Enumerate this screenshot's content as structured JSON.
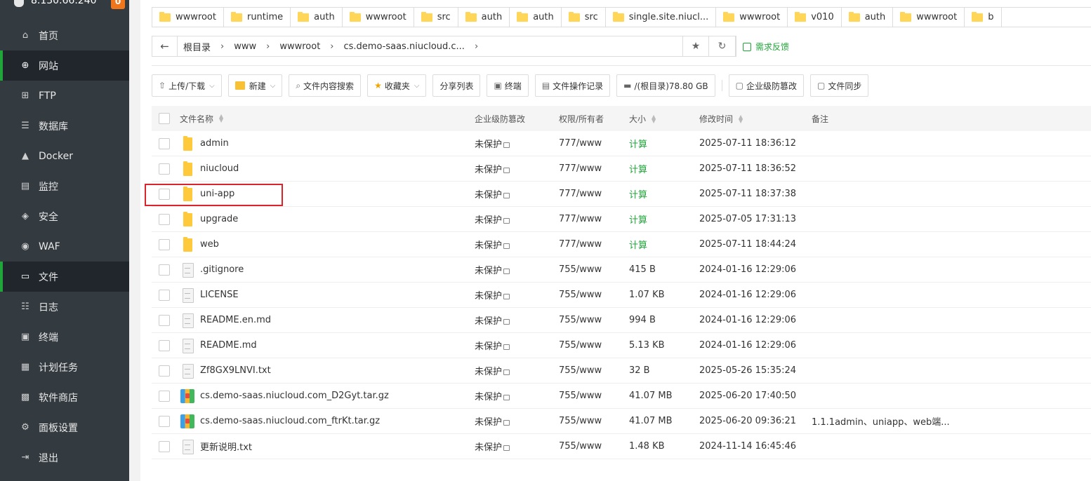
{
  "server": {
    "ip": "8.130.66.240",
    "badge": "0"
  },
  "nav": [
    {
      "label": "首页",
      "icon": "home-icon",
      "glyph": "⌂",
      "active": false
    },
    {
      "label": "网站",
      "icon": "globe-icon",
      "glyph": "⊕",
      "active": true
    },
    {
      "label": "FTP",
      "icon": "ftp-icon",
      "glyph": "⊞",
      "active": false
    },
    {
      "label": "数据库",
      "icon": "database-icon",
      "glyph": "☰",
      "active": false
    },
    {
      "label": "Docker",
      "icon": "docker-icon",
      "glyph": "▲",
      "active": false
    },
    {
      "label": "监控",
      "icon": "monitor-icon",
      "glyph": "▤",
      "active": false
    },
    {
      "label": "安全",
      "icon": "shield-icon",
      "glyph": "◈",
      "active": false
    },
    {
      "label": "WAF",
      "icon": "waf-icon",
      "glyph": "◉",
      "active": false
    },
    {
      "label": "文件",
      "icon": "folder-icon",
      "glyph": "▭",
      "active": true
    },
    {
      "label": "日志",
      "icon": "log-icon",
      "glyph": "☷",
      "active": false
    },
    {
      "label": "终端",
      "icon": "terminal-icon",
      "glyph": "▣",
      "active": false
    },
    {
      "label": "计划任务",
      "icon": "calendar-icon",
      "glyph": "▦",
      "active": false
    },
    {
      "label": "软件商店",
      "icon": "store-icon",
      "glyph": "▩",
      "active": false
    },
    {
      "label": "面板设置",
      "icon": "gear-icon",
      "glyph": "⚙",
      "active": false
    },
    {
      "label": "退出",
      "icon": "logout-icon",
      "glyph": "⇥",
      "active": false
    }
  ],
  "bookmarks": [
    "wwwroot",
    "runtime",
    "auth",
    "wwwroot",
    "src",
    "auth",
    "auth",
    "src",
    "single.site.niucl...",
    "wwwroot",
    "v010",
    "auth",
    "wwwroot",
    "b"
  ],
  "path": {
    "back": "←",
    "crumbs": [
      "根目录",
      "www",
      "wwwroot",
      "cs.demo-saas.niucloud.c..."
    ],
    "star": "★",
    "refresh": "↻"
  },
  "feedback": "需求反馈",
  "toolbar": [
    {
      "label": "上传/下载",
      "icon": "upload-icon",
      "glyph": "⇧",
      "caret": true
    },
    {
      "label": "新建",
      "icon": "new-icon",
      "glyph": "",
      "caret": true,
      "new": true
    },
    {
      "label": "文件内容搜索",
      "icon": "search-icon",
      "glyph": "⌕",
      "caret": false
    },
    {
      "label": "收藏夹",
      "icon": "star-icon",
      "glyph": "★",
      "caret": true,
      "star": true
    },
    {
      "label": "分享列表",
      "icon": "",
      "glyph": "",
      "caret": false
    },
    {
      "label": "终端",
      "icon": "terminal-icon",
      "glyph": "▣",
      "caret": false
    },
    {
      "label": "文件操作记录",
      "icon": "record-icon",
      "glyph": "▤",
      "caret": false
    },
    {
      "label": "/(根目录)78.80 GB",
      "icon": "disk-icon",
      "glyph": "▬",
      "caret": false
    },
    {
      "label": "企业级防篡改",
      "icon": "tamper-icon",
      "glyph": "▢",
      "caret": false,
      "divBefore": true
    },
    {
      "label": "文件同步",
      "icon": "sync-icon",
      "glyph": "▢",
      "caret": false
    }
  ],
  "table": {
    "headers": {
      "name": "文件名称",
      "prot": "企业级防篡改",
      "perm": "权限/所有者",
      "size": "大小",
      "time": "修改时间",
      "note": "备注"
    },
    "rows": [
      {
        "type": "folder",
        "name": "admin",
        "prot": "未保护",
        "perm": "777/www",
        "size": "计算",
        "calc": true,
        "time": "2025-07-11 18:36:12",
        "note": ""
      },
      {
        "type": "folder",
        "name": "niucloud",
        "prot": "未保护",
        "perm": "777/www",
        "size": "计算",
        "calc": true,
        "time": "2025-07-11 18:36:52",
        "note": ""
      },
      {
        "type": "folder",
        "name": "uni-app",
        "prot": "未保护",
        "perm": "777/www",
        "size": "计算",
        "calc": true,
        "time": "2025-07-11 18:37:38",
        "note": ""
      },
      {
        "type": "folder",
        "name": "upgrade",
        "prot": "未保护",
        "perm": "777/www",
        "size": "计算",
        "calc": true,
        "time": "2025-07-05 17:31:13",
        "note": ""
      },
      {
        "type": "folder",
        "name": "web",
        "prot": "未保护",
        "perm": "777/www",
        "size": "计算",
        "calc": true,
        "time": "2025-07-11 18:44:24",
        "note": ""
      },
      {
        "type": "file",
        "name": ".gitignore",
        "prot": "未保护",
        "perm": "755/www",
        "size": "415 B",
        "calc": false,
        "time": "2024-01-16 12:29:06",
        "note": ""
      },
      {
        "type": "file",
        "name": "LICENSE",
        "prot": "未保护",
        "perm": "755/www",
        "size": "1.07 KB",
        "calc": false,
        "time": "2024-01-16 12:29:06",
        "note": ""
      },
      {
        "type": "file",
        "name": "README.en.md",
        "prot": "未保护",
        "perm": "755/www",
        "size": "994 B",
        "calc": false,
        "time": "2024-01-16 12:29:06",
        "note": ""
      },
      {
        "type": "file",
        "name": "README.md",
        "prot": "未保护",
        "perm": "755/www",
        "size": "5.13 KB",
        "calc": false,
        "time": "2024-01-16 12:29:06",
        "note": ""
      },
      {
        "type": "file",
        "name": "Zf8GX9LNVI.txt",
        "prot": "未保护",
        "perm": "755/www",
        "size": "32 B",
        "calc": false,
        "time": "2025-05-26 15:35:24",
        "note": ""
      },
      {
        "type": "archive",
        "name": "cs.demo-saas.niucloud.com_D2Gyt.tar.gz",
        "prot": "未保护",
        "perm": "755/www",
        "size": "41.07 MB",
        "calc": false,
        "time": "2025-06-20 17:40:50",
        "note": ""
      },
      {
        "type": "archive",
        "name": "cs.demo-saas.niucloud.com_ftrKt.tar.gz",
        "prot": "未保护",
        "perm": "755/www",
        "size": "41.07 MB",
        "calc": false,
        "time": "2025-06-20 09:36:21",
        "note": "1.1.1admin、uniapp、web端..."
      },
      {
        "type": "file",
        "name": "更新说明.txt",
        "prot": "未保护",
        "perm": "755/www",
        "size": "1.48 KB",
        "calc": false,
        "time": "2024-11-14 16:45:46",
        "note": ""
      }
    ]
  },
  "highlight_row": "uni-app",
  "colors": {
    "accent": "#20a53a",
    "sidebar": "#333a40",
    "highlight": "#d9242a"
  }
}
